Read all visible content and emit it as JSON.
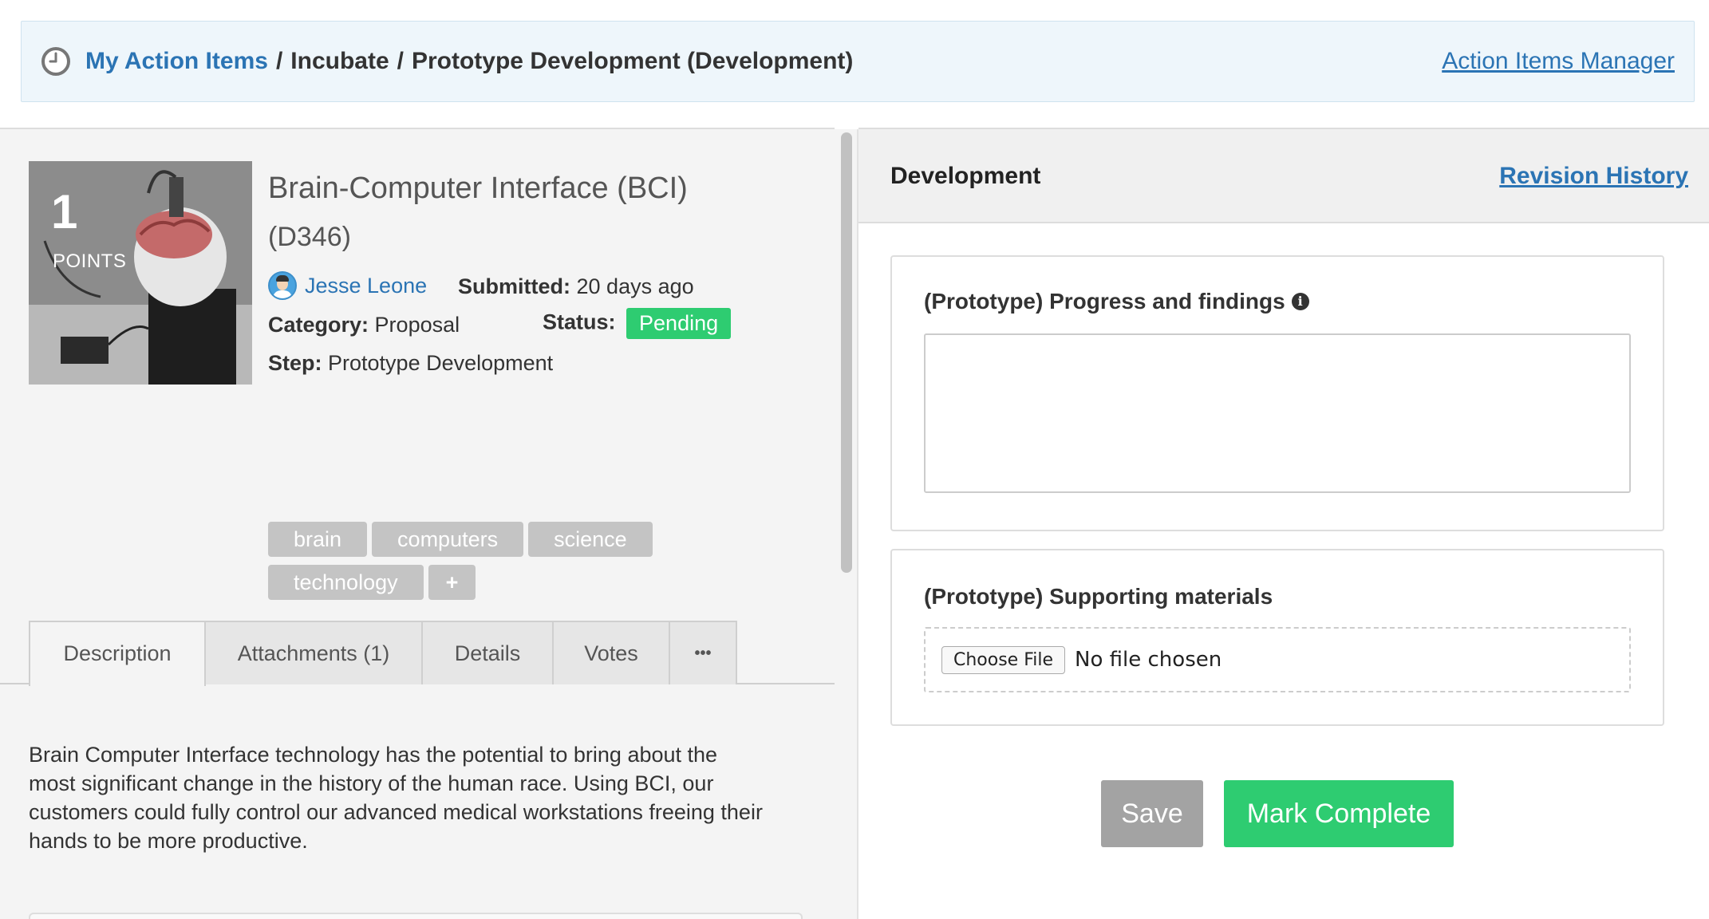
{
  "breadcrumb": {
    "root": "My Action Items",
    "sep": "/",
    "level1": "Incubate",
    "level2": "Prototype Development (Development)",
    "manager_link": "Action Items Manager"
  },
  "idea": {
    "points": "1",
    "points_label": "POINTS",
    "title": "Brain-Computer Interface (BCI)",
    "code": "(D346)",
    "author": "Jesse Leone",
    "submitted_label": "Submitted:",
    "submitted_value": "20 days ago",
    "category_label": "Category:",
    "category_value": "Proposal",
    "status_label": "Status:",
    "status_value": "Pending",
    "step_label": "Step:",
    "step_value": "Prototype Development",
    "tags": [
      "brain",
      "computers",
      "science",
      "technology"
    ],
    "add_tag": "+"
  },
  "tabs": [
    {
      "label": "Description"
    },
    {
      "label": "Attachments (1)"
    },
    {
      "label": "Details"
    },
    {
      "label": "Votes"
    },
    {
      "label": "•••"
    }
  ],
  "description": "Brain Computer Interface technology has the potential to bring about the most significant change in the history of the human race.  Using BCI, our customers could fully control our advanced medical workstations freeing their hands to be more productive.",
  "panel": {
    "title": "Development",
    "revision_link": "Revision History",
    "field1_label": "(Prototype) Progress and findings",
    "field1_value": "",
    "field2_label": "(Prototype) Supporting materials",
    "choose_file": "Choose File",
    "no_file": "No file chosen",
    "save": "Save",
    "mark_complete": "Mark Complete"
  },
  "colors": {
    "link": "#2b74b4",
    "success": "#2ecc71",
    "tag": "#c4c4c4",
    "disabled": "#a3a3a3"
  }
}
